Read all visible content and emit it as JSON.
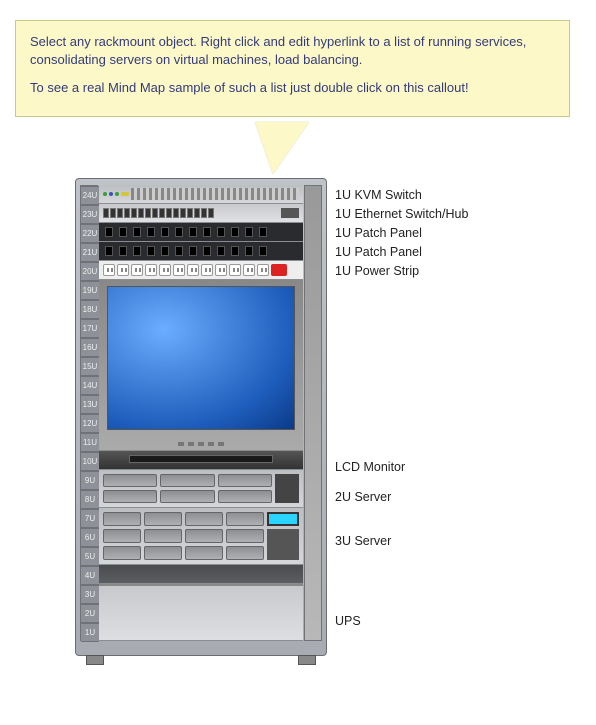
{
  "callout": {
    "line1": "Select any rackmount object. Right click and edit hyperlink to a list of running services, consolidating servers on virtual machines, load balancing.",
    "line2": "To see a real Mind Map sample of such a list just double click on this callout!"
  },
  "rack": {
    "u_labels": [
      "24U",
      "23U",
      "22U",
      "21U",
      "20U",
      "19U",
      "18U",
      "17U",
      "16U",
      "15U",
      "14U",
      "13U",
      "12U",
      "11U",
      "10U",
      "9U",
      "8U",
      "7U",
      "6U",
      "5U",
      "4U",
      "3U",
      "2U",
      "1U"
    ]
  },
  "devices": {
    "kvm": "1U KVM Switch",
    "eth": "1U Ethernet Switch/Hub",
    "patch1": "1U Patch Panel",
    "patch2": "1U Patch Panel",
    "power": "1U Power Strip",
    "lcd": "LCD Monitor",
    "server2u": "2U Server",
    "server3u": "3U Server",
    "ups": "UPS"
  }
}
